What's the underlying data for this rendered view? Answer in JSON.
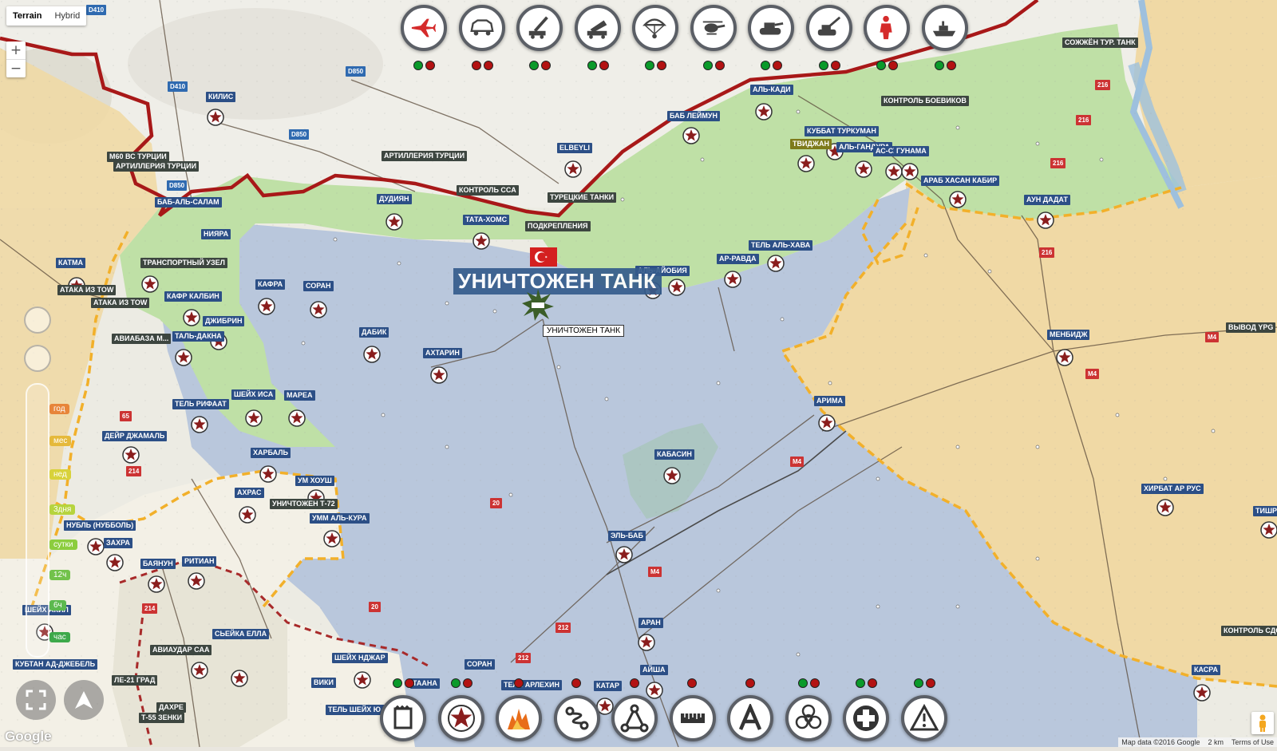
{
  "map_type": {
    "terrain": "Terrain",
    "hybrid": "Hybrid",
    "active": "Terrain"
  },
  "zoom": {
    "in": "+",
    "out": "−"
  },
  "timeline": {
    "year": "год",
    "month": "мес",
    "week": "нед",
    "three_days": "3дня",
    "day": "сутки",
    "h12": "12ч",
    "h6": "6ч",
    "hour": "час"
  },
  "colors": {
    "turkey_fsa_zone": "#bfe0a6",
    "isis_zone": "#b9c7dc",
    "sdf_zone": "#f0d9a5",
    "regime_zone": "#f3f0e6",
    "border": "#b01e1e",
    "frontline": "#f2b02a",
    "label_blue": "#2c4f86",
    "label_dark": "#3d4640"
  },
  "top_toolbar": [
    {
      "name": "aircraft-icon",
      "dots": [
        "g",
        "r"
      ]
    },
    {
      "name": "armored-car-icon",
      "dots": [
        "r",
        "r"
      ]
    },
    {
      "name": "rocket-launcher-icon",
      "dots": [
        "g",
        "r"
      ]
    },
    {
      "name": "mlrs-icon",
      "dots": [
        "g",
        "r"
      ]
    },
    {
      "name": "paratrooper-icon",
      "dots": [
        "g",
        "r"
      ]
    },
    {
      "name": "helicopter-icon",
      "dots": [
        "g",
        "r"
      ]
    },
    {
      "name": "tank-icon",
      "dots": [
        "g",
        "r"
      ]
    },
    {
      "name": "artillery-icon",
      "dots": [
        "g",
        "r"
      ]
    },
    {
      "name": "soldier-icon",
      "dots": [
        "g",
        "r"
      ]
    },
    {
      "name": "warship-icon",
      "dots": [
        "g",
        "r"
      ]
    }
  ],
  "bottom_toolbar": [
    {
      "name": "flag-icon",
      "dots": [
        "g",
        "r"
      ]
    },
    {
      "name": "star-icon",
      "dots": [
        "g",
        "r"
      ]
    },
    {
      "name": "fire-icon",
      "dots": [
        "r"
      ]
    },
    {
      "name": "route-icon",
      "dots": [
        "r"
      ]
    },
    {
      "name": "triangle-nodes-icon",
      "dots": [
        "r"
      ]
    },
    {
      "name": "ruler-icon",
      "dots": [
        "r"
      ]
    },
    {
      "name": "text-a-icon",
      "dots": [
        "r"
      ]
    },
    {
      "name": "biohazard-icon",
      "dots": [
        "g",
        "r"
      ]
    },
    {
      "name": "medical-icon",
      "dots": [
        "g",
        "r"
      ]
    },
    {
      "name": "warning-icon",
      "dots": [
        "g",
        "r"
      ]
    }
  ],
  "headline": "УНИЧТОЖЕН ТАНК",
  "tooltip": "УНИЧТОЖЕН ТАНК",
  "road_labels": [
    "D410",
    "D410",
    "D850",
    "D850",
    "D850",
    "216",
    "216",
    "216",
    "216",
    "M4",
    "M4",
    "M4",
    "M4",
    "212",
    "212",
    "20",
    "20",
    "214",
    "214",
    "65"
  ],
  "places": [
    {
      "t": "СОЖЖЁН ТУР. ТАНК",
      "c": "dark"
    },
    {
      "t": "АЛЬ-КАДИ",
      "c": "blue"
    },
    {
      "t": "БАБ ЛЕЙМУН",
      "c": "blue"
    },
    {
      "t": "КОНТРОЛЬ БОЕВИКОВ",
      "c": "dark"
    },
    {
      "t": "КУББАТ ТУРКУМАН",
      "c": "blue"
    },
    {
      "t": "ТВИДЖАН",
      "c": "olive"
    },
    {
      "t": "АЛЬ-ГАНДУРА",
      "c": "blue"
    },
    {
      "t": "АС-СУ",
      "c": "blue"
    },
    {
      "t": "ГУНАМА",
      "c": "blue"
    },
    {
      "t": "АРАБ ХАСАН КАБИР",
      "c": "blue"
    },
    {
      "t": "АУН ДАДАТ",
      "c": "blue"
    },
    {
      "t": "КИЛИС",
      "c": "blue"
    },
    {
      "t": "M60 ВС ТУРЦИИ",
      "c": "dark"
    },
    {
      "t": "АРТИЛЛЕРИЯ ТУРЦИИ",
      "c": "dark"
    },
    {
      "t": "АРТИЛЛЕРИЯ ТУРЦИИ",
      "c": "dark"
    },
    {
      "t": "ELBEYLI",
      "c": "blue"
    },
    {
      "t": "БАБ-АЛЬ-САЛАМ",
      "c": "blue"
    },
    {
      "t": "ДУДИЯН",
      "c": "blue"
    },
    {
      "t": "КОНТРОЛЬ ССА",
      "c": "dark"
    },
    {
      "t": "ТУРЕЦКИЕ ТАНКИ",
      "c": "dark"
    },
    {
      "t": "ТАТА-ХОМС",
      "c": "blue"
    },
    {
      "t": "ПОДКРЕПЛЕНИЯ",
      "c": "dark"
    },
    {
      "t": "НИЯРА",
      "c": "blue"
    },
    {
      "t": "ТРАНСПОРТНЫЙ УЗЕЛ",
      "c": "dark"
    },
    {
      "t": "КАТМА",
      "c": "blue"
    },
    {
      "t": "АТАКА ИЗ ТОW",
      "c": "dark"
    },
    {
      "t": "АТАКА ИЗ ТОW",
      "c": "dark"
    },
    {
      "t": "КАФРА",
      "c": "blue"
    },
    {
      "t": "СОРАН",
      "c": "blue"
    },
    {
      "t": "КАФР КАЛБИН",
      "c": "blue"
    },
    {
      "t": "ДЖИБРИН",
      "c": "blue"
    },
    {
      "t": "ТАЛЬ-ДАКНА",
      "c": "blue"
    },
    {
      "t": "АВИАБАЗА М...",
      "c": "dark"
    },
    {
      "t": "ДАБИК",
      "c": "blue"
    },
    {
      "t": "АХТАРИН",
      "c": "blue"
    },
    {
      "t": "АЛЬ-АЙОБИЯ",
      "c": "blue"
    },
    {
      "t": "АР-РАВДА",
      "c": "blue"
    },
    {
      "t": "ТЕЛЬ АЛЬ-ХАВА",
      "c": "blue"
    },
    {
      "t": "МЕНБИДЖ",
      "c": "blue"
    },
    {
      "t": "ВЫВОД YPG",
      "c": "dark"
    },
    {
      "t": "АРИМА",
      "c": "blue"
    },
    {
      "t": "ТЕЛЬ РИФААТ",
      "c": "blue"
    },
    {
      "t": "ШЕЙХ ИСА",
      "c": "blue"
    },
    {
      "t": "МАРЕА",
      "c": "blue"
    },
    {
      "t": "ДЕЙР ДЖАМАЛЬ",
      "c": "blue"
    },
    {
      "t": "ХАРБАЛЬ",
      "c": "blue"
    },
    {
      "t": "УМ ХОУШ",
      "c": "blue"
    },
    {
      "t": "УНИЧТОЖЕН Т-72",
      "c": "dark"
    },
    {
      "t": "АХРАС",
      "c": "blue"
    },
    {
      "t": "УММ АЛЬ-КУРА",
      "c": "blue"
    },
    {
      "t": "НУБЛЬ (НУББОЛЬ)",
      "c": "blue"
    },
    {
      "t": "ЗАХРА",
      "c": "blue"
    },
    {
      "t": "КАБАСИН",
      "c": "blue"
    },
    {
      "t": "ХИРБАТ АР РУС",
      "c": "blue"
    },
    {
      "t": "ТИШРИН",
      "c": "blue"
    },
    {
      "t": "БАЯНУН",
      "c": "blue"
    },
    {
      "t": "РИТИАН",
      "c": "blue"
    },
    {
      "t": "ЭЛЬ-БАБ",
      "c": "blue"
    },
    {
      "t": "ШЕЙХ АКИЛ",
      "c": "blue"
    },
    {
      "t": "АРАН",
      "c": "blue"
    },
    {
      "t": "КОНТРОЛЬ СДС",
      "c": "dark"
    },
    {
      "t": "АЙША",
      "c": "blue"
    },
    {
      "t": "КУБТАН АД-ДЖЕБЕЛЬ",
      "c": "blue"
    },
    {
      "t": "ЛЕ-21 ГРАД",
      "c": "dark"
    },
    {
      "t": "АВИАУДАР САА",
      "c": "dark"
    },
    {
      "t": "СЬЕЙКА ЕЛЛА",
      "c": "blue"
    },
    {
      "t": "ШЕЙХ НДЖАР",
      "c": "blue"
    },
    {
      "t": "СОРАН",
      "c": "blue"
    },
    {
      "t": "ТААНА",
      "c": "blue"
    },
    {
      "t": "ТЕЛЬ АРЛЕХИН",
      "c": "blue"
    },
    {
      "t": "КАТАР",
      "c": "blue"
    },
    {
      "t": "КАСРА",
      "c": "blue"
    },
    {
      "t": "ДАХРЕ",
      "c": "dark"
    },
    {
      "t": "Т-55 ЗЕНКИ",
      "c": "dark"
    },
    {
      "t": "ТЕЛЬ ШЕЙХ Ю...",
      "c": "blue"
    },
    {
      "t": "ВИКИ",
      "c": "blue"
    }
  ],
  "attribution": {
    "data": "Map data ©2016 Google",
    "scale": "2 km",
    "terms": "Terms of Use"
  },
  "google": "Google"
}
